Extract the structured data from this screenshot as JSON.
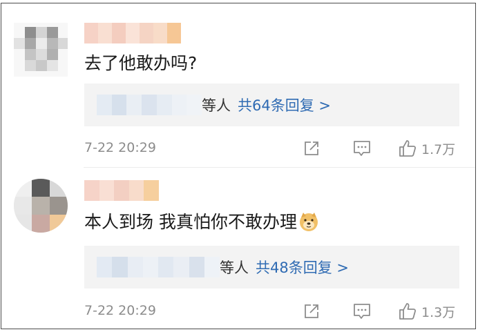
{
  "comments": [
    {
      "text": "去了他敢办吗?",
      "replies_suffix": "等人",
      "reply_count": "共64条回复 >",
      "time": "7-22 20:29",
      "likes": "1.7万"
    },
    {
      "text": "本人到场 我真怕你不敢办理",
      "replies_suffix": "等人",
      "reply_count": "共48条回复 >",
      "time": "7-22 20:29",
      "likes": "1.3万"
    }
  ],
  "icons": {
    "share": "share-icon",
    "comment": "comment-icon",
    "like": "thumbs-up-icon",
    "emoji": "doge-emoji-icon"
  },
  "colors": {
    "link": "#2f6bb3",
    "meta": "#8c8c8c",
    "reply_bg": "#f3f3f3"
  }
}
